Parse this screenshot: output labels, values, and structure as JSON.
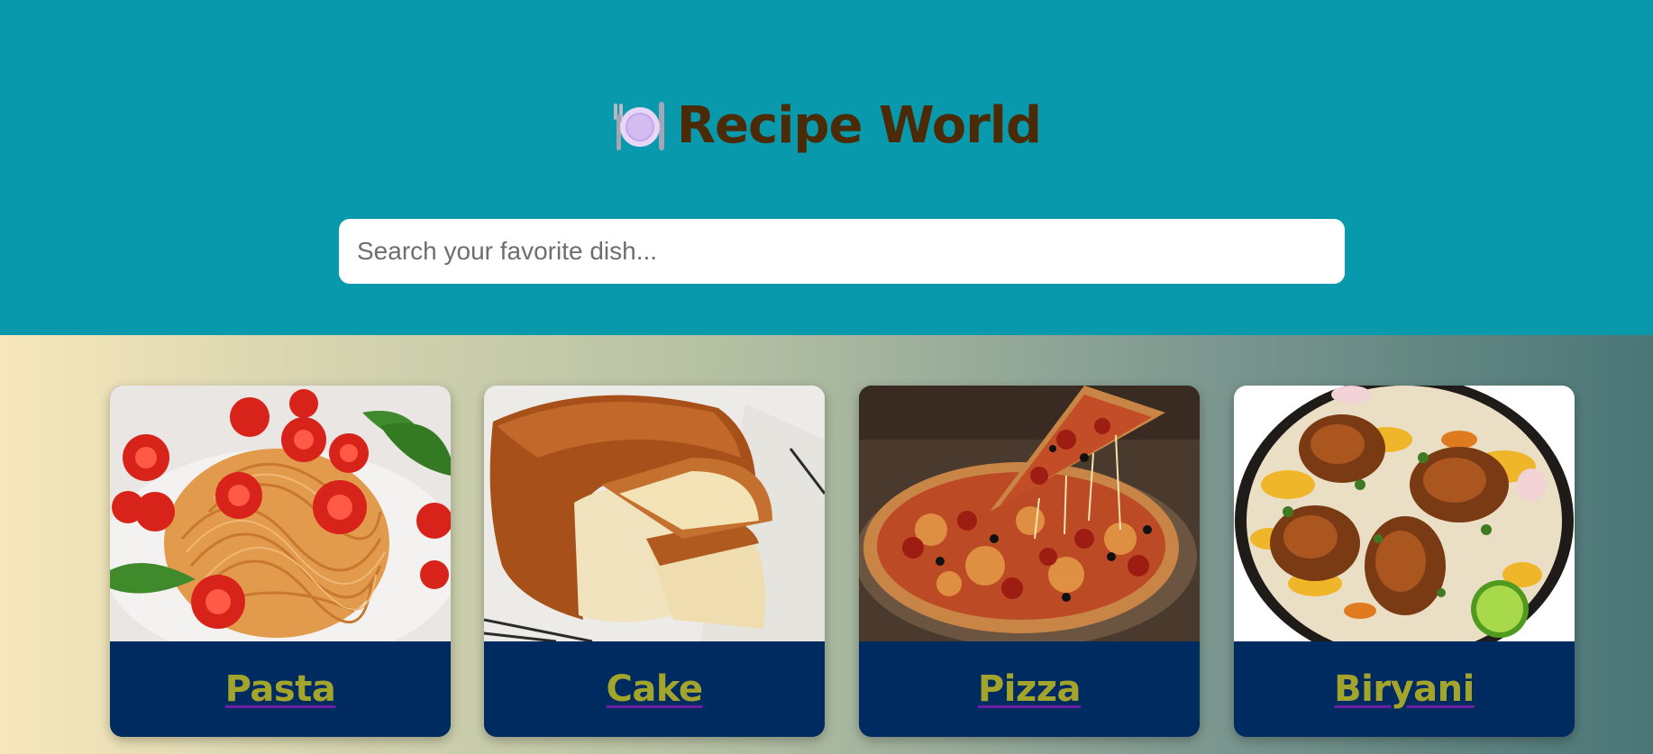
{
  "header": {
    "title": "Recipe World",
    "icon": "fork-knife-plate-icon",
    "background": "#0899ad",
    "title_color": "#4b2a07"
  },
  "search": {
    "placeholder": "Search your favorite dish...",
    "value": ""
  },
  "recipes": [
    {
      "name": "Pasta",
      "image_icon": "pasta-image"
    },
    {
      "name": "Cake",
      "image_icon": "cake-image"
    },
    {
      "name": "Pizza",
      "image_icon": "pizza-image"
    },
    {
      "name": "Biryani",
      "image_icon": "biryani-image"
    }
  ],
  "colors": {
    "card_footer": "#002b60",
    "card_label": "#a3a42c",
    "link_underline": "#6a1fa6"
  }
}
